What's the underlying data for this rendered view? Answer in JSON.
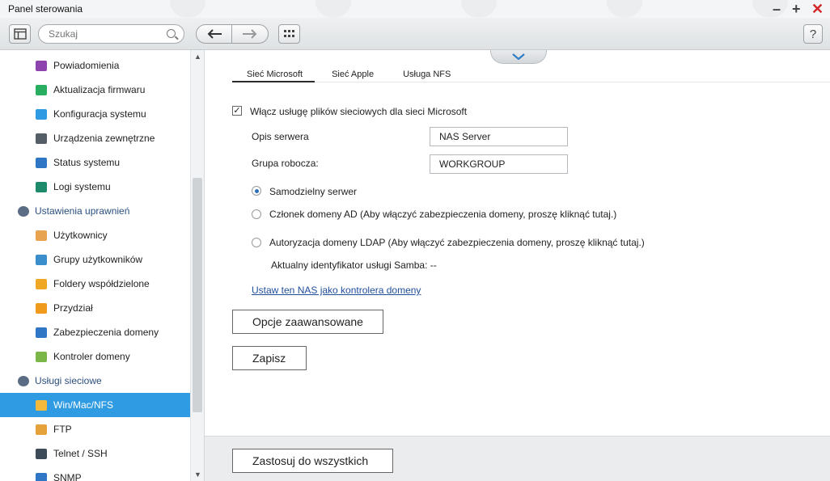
{
  "window": {
    "title": "Panel sterowania",
    "minimize": "–",
    "maximize": "+",
    "close": "✕"
  },
  "toolbar": {
    "search_placeholder": "Szukaj",
    "help": "?"
  },
  "sidebar": {
    "items": [
      {
        "label": "Powiadomienia",
        "icon": "notification-icon",
        "color": "#8e44ad",
        "kind": "sub"
      },
      {
        "label": "Aktualizacja firmwaru",
        "icon": "firmware-update-icon",
        "color": "#27ae60",
        "kind": "sub"
      },
      {
        "label": "Konfiguracja systemu",
        "icon": "system-config-icon",
        "color": "#2f9be3",
        "kind": "sub"
      },
      {
        "label": "Urządzenia zewnętrzne",
        "icon": "external-device-icon",
        "color": "#555e66",
        "kind": "sub"
      },
      {
        "label": "Status systemu",
        "icon": "system-status-icon",
        "color": "#2f76c4",
        "kind": "sub"
      },
      {
        "label": "Logi systemu",
        "icon": "system-logs-icon",
        "color": "#1f8a6b",
        "kind": "sub"
      },
      {
        "label": "Ustawienia uprawnień",
        "icon": "user-permissions-icon",
        "color": "#5a6d84",
        "kind": "cat"
      },
      {
        "label": "Użytkownicy",
        "icon": "user-icon",
        "color": "#e7a34f",
        "kind": "sub"
      },
      {
        "label": "Grupy użytkowników",
        "icon": "user-group-icon",
        "color": "#3a8ecc",
        "kind": "sub"
      },
      {
        "label": "Foldery współdzielone",
        "icon": "shared-folder-icon",
        "color": "#f0a724",
        "kind": "sub"
      },
      {
        "label": "Przydział",
        "icon": "quota-icon",
        "color": "#f09a1c",
        "kind": "sub"
      },
      {
        "label": "Zabezpieczenia domeny",
        "icon": "domain-security-icon",
        "color": "#2f76c4",
        "kind": "sub"
      },
      {
        "label": "Kontroler domeny",
        "icon": "domain-controller-icon",
        "color": "#7ab648",
        "kind": "sub"
      },
      {
        "label": "Usługi sieciowe",
        "icon": "network-services-icon",
        "color": "#5a6d84",
        "kind": "cat"
      },
      {
        "label": "Win/Mac/NFS",
        "icon": "win-mac-nfs-icon",
        "color": "#f3b93a",
        "kind": "sub",
        "active": true
      },
      {
        "label": "FTP",
        "icon": "ftp-icon",
        "color": "#e5a23a",
        "kind": "sub"
      },
      {
        "label": "Telnet / SSH",
        "icon": "telnet-ssh-icon",
        "color": "#3d4a57",
        "kind": "sub"
      },
      {
        "label": "SNMP",
        "icon": "snmp-icon",
        "color": "#2f76c4",
        "kind": "sub"
      }
    ]
  },
  "tabs": [
    "Sieć Microsoft",
    "Sieć Apple",
    "Usługa NFS"
  ],
  "form": {
    "enable_label": "Włącz usługę plików sieciowych dla sieci Microsoft",
    "enable_checked": true,
    "server_desc_label": "Opis serwera",
    "server_desc_value": "NAS Server",
    "workgroup_label": "Grupa robocza:",
    "workgroup_value": "WORKGROUP",
    "radio_standalone": "Samodzielny serwer",
    "radio_ad": "Członek domeny AD (Aby włączyć zabezpieczenia domeny, proszę kliknąć tutaj.)",
    "radio_ldap": "Autoryzacja domeny LDAP (Aby włączyć zabezpieczenia domeny, proszę kliknąć tutaj.)",
    "samba_id": "Aktualny identyfikator usługi Samba: --",
    "dc_link": "Ustaw ten NAS jako kontrolera domeny",
    "advanced_button": "Opcje zaawansowane",
    "save_button": "Zapisz"
  },
  "footer": {
    "apply_all_button": "Zastosuj do wszystkich"
  },
  "colors": {
    "accent": "#2f9be3",
    "link": "#1f4e9a",
    "close": "#d4262a"
  }
}
